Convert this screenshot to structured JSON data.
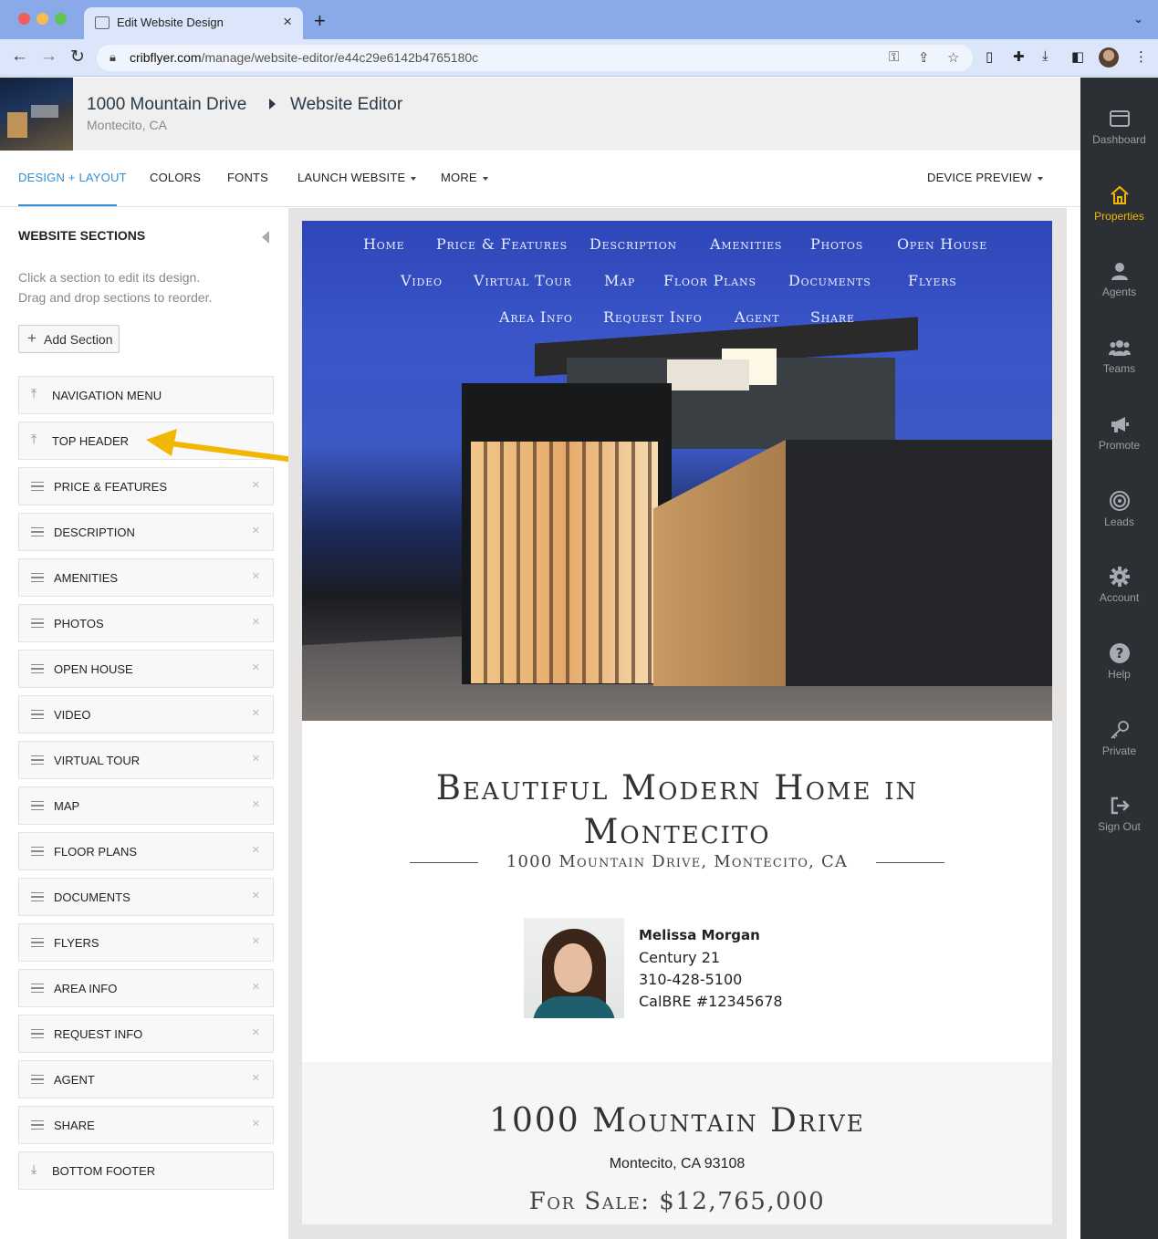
{
  "browser": {
    "tab_title": "Edit Website Design",
    "url_domain": "cribflyer.com",
    "url_path": "/manage/website-editor/e44c29e6142b4765180c",
    "colors": {
      "tabbar": "#8aa9e8",
      "toolbar": "#dbe6fb"
    }
  },
  "header": {
    "property_title": "1000 Mountain Drive",
    "editor_title": "Website Editor",
    "location": "Montecito, CA"
  },
  "menu": {
    "design_layout": "DESIGN + LAYOUT",
    "colors": "COLORS",
    "fonts": "FONTS",
    "launch_website": "LAUNCH WEBSITE",
    "more": "MORE",
    "device_preview": "DEVICE PREVIEW",
    "accent_color": "#2f8fd6"
  },
  "sidebar": {
    "heading": "WEBSITE SECTIONS",
    "help_line1": "Click a section to edit its design.",
    "help_line2": "Drag and drop sections to reorder.",
    "add_section": "Add Section",
    "sections": [
      {
        "label": "NAVIGATION MENU",
        "icon": "pin-top-icon",
        "removable": false
      },
      {
        "label": "TOP HEADER",
        "icon": "pin-top-icon",
        "removable": false
      },
      {
        "label": "PRICE & FEATURES",
        "icon": "drag-handle-icon",
        "removable": true
      },
      {
        "label": "DESCRIPTION",
        "icon": "drag-handle-icon",
        "removable": true
      },
      {
        "label": "AMENITIES",
        "icon": "drag-handle-icon",
        "removable": true
      },
      {
        "label": "PHOTOS",
        "icon": "drag-handle-icon",
        "removable": true
      },
      {
        "label": "OPEN HOUSE",
        "icon": "drag-handle-icon",
        "removable": true
      },
      {
        "label": "VIDEO",
        "icon": "drag-handle-icon",
        "removable": true
      },
      {
        "label": "VIRTUAL TOUR",
        "icon": "drag-handle-icon",
        "removable": true
      },
      {
        "label": "MAP",
        "icon": "drag-handle-icon",
        "removable": true
      },
      {
        "label": "FLOOR PLANS",
        "icon": "drag-handle-icon",
        "removable": true
      },
      {
        "label": "DOCUMENTS",
        "icon": "drag-handle-icon",
        "removable": true
      },
      {
        "label": "FLYERS",
        "icon": "drag-handle-icon",
        "removable": true
      },
      {
        "label": "AREA INFO",
        "icon": "drag-handle-icon",
        "removable": true
      },
      {
        "label": "REQUEST INFO",
        "icon": "drag-handle-icon",
        "removable": true
      },
      {
        "label": "AGENT",
        "icon": "drag-handle-icon",
        "removable": true
      },
      {
        "label": "SHARE",
        "icon": "drag-handle-icon",
        "removable": true
      },
      {
        "label": "BOTTOM FOOTER",
        "icon": "pin-bottom-icon",
        "removable": false
      }
    ],
    "annotation_arrow_color": "#f2b705"
  },
  "preview": {
    "nav_rows": [
      [
        "Home",
        "Price & Features",
        "Description",
        "Amenities",
        "Photos",
        "Open House"
      ],
      [
        "Video",
        "Virtual Tour",
        "Map",
        "Floor Plans",
        "Documents",
        "Flyers"
      ],
      [
        "Area Info",
        "Request Info",
        "Agent",
        "Share"
      ]
    ],
    "headline_line1": "Beautiful Modern Home in",
    "headline_line2": "Montecito",
    "address": "1000 Mountain Drive, Montecito, CA",
    "agent": {
      "name": "Melissa Morgan",
      "company": "Century 21",
      "phone": "310-428-5100",
      "license": "CalBRE #12345678"
    },
    "price_section": {
      "title": "1000 Mountain Drive",
      "city": "Montecito, CA 93108",
      "price": "For Sale: $12,765,000"
    }
  },
  "rightnav": {
    "items": [
      {
        "label": "Dashboard",
        "icon": "window-icon",
        "active": false
      },
      {
        "label": "Properties",
        "icon": "home-icon",
        "active": true
      },
      {
        "label": "Agents",
        "icon": "user-icon",
        "active": false
      },
      {
        "label": "Teams",
        "icon": "users-icon",
        "active": false
      },
      {
        "label": "Promote",
        "icon": "megaphone-icon",
        "active": false
      },
      {
        "label": "Leads",
        "icon": "target-icon",
        "active": false
      },
      {
        "label": "Account",
        "icon": "gear-icon",
        "active": false
      },
      {
        "label": "Help",
        "icon": "question-icon",
        "active": false
      },
      {
        "label": "Private",
        "icon": "key-icon",
        "active": false
      },
      {
        "label": "Sign Out",
        "icon": "sign-out-icon",
        "active": false
      }
    ],
    "active_color": "#f2b705"
  }
}
